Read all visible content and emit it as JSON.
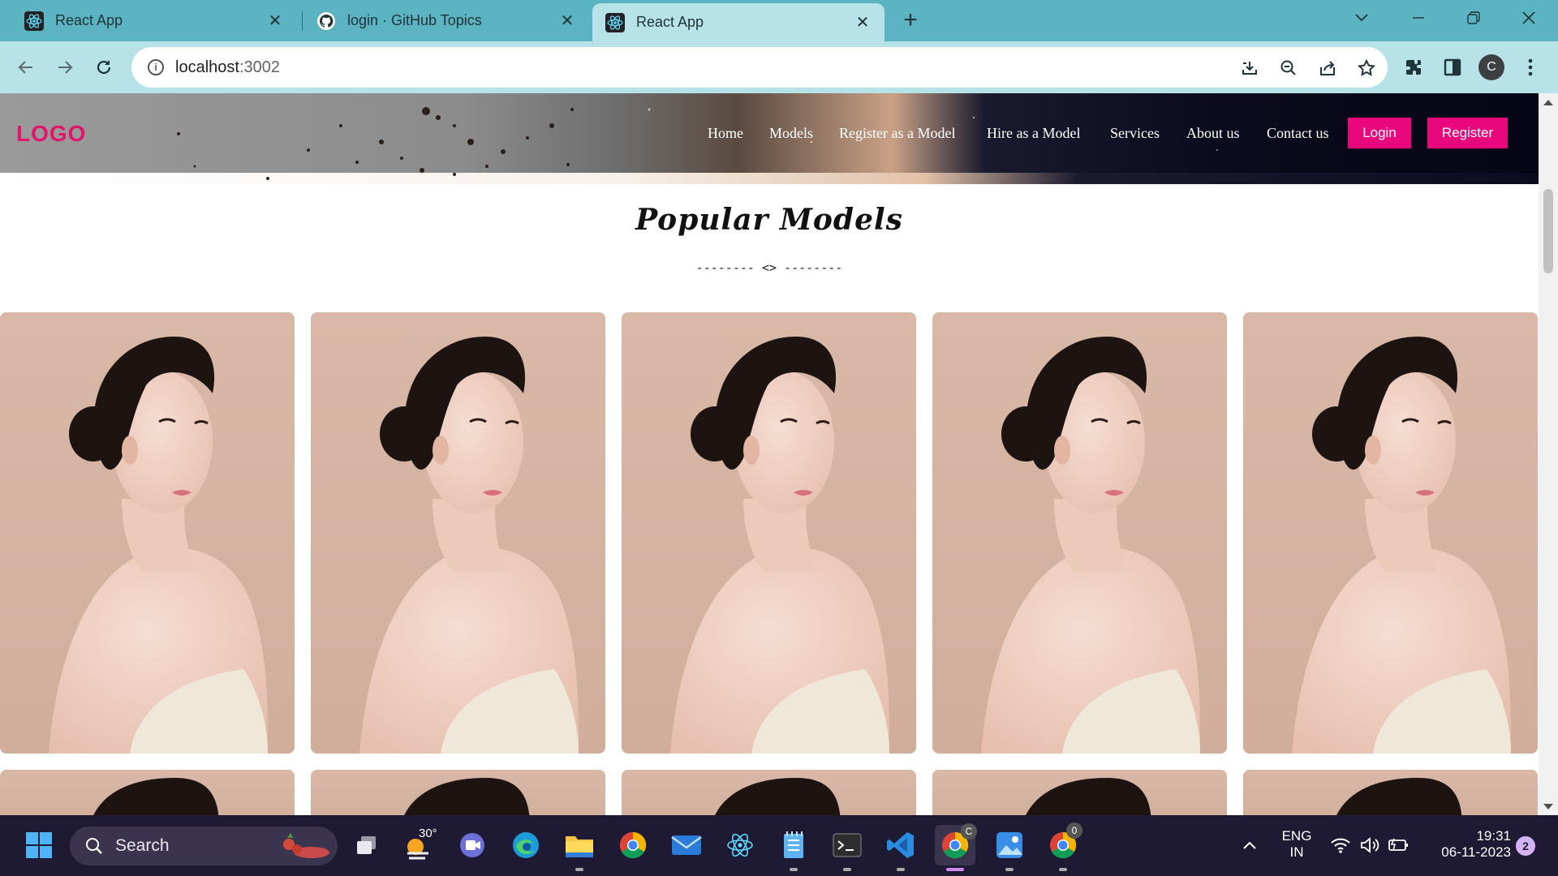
{
  "browser": {
    "tabs": [
      {
        "title": "React App",
        "icon": "react-icon",
        "active": false
      },
      {
        "title": "login · GitHub Topics",
        "icon": "github-icon",
        "active": false
      },
      {
        "title": "React App",
        "icon": "react-icon",
        "active": true
      }
    ],
    "address": {
      "host": "localhost",
      "port": ":3002"
    },
    "profile_initial": "C"
  },
  "site": {
    "logo": "LOGO",
    "nav": [
      "Home",
      "Models",
      "Register as a Model",
      "Hire as a Model",
      "Services",
      "About us",
      "Contact us"
    ],
    "login_label": "Login",
    "register_label": "Register",
    "section_title": "Popular Models",
    "divider": "-------- <> --------",
    "card_count_visible": 10
  },
  "taskbar": {
    "search_placeholder": "Search",
    "weather_temp": "30°",
    "language": "ENG",
    "region": "IN",
    "time": "19:31",
    "date": "06-11-2023",
    "notification_count": "2",
    "chrome_profile_badges": [
      "C",
      "0"
    ]
  },
  "colors": {
    "tabbar": "#5cb3c1",
    "toolbar": "#b7e2e8",
    "accent_pink": "#e8087b",
    "logo_pink": "#e1156b",
    "taskbar": "#1f1a33"
  }
}
